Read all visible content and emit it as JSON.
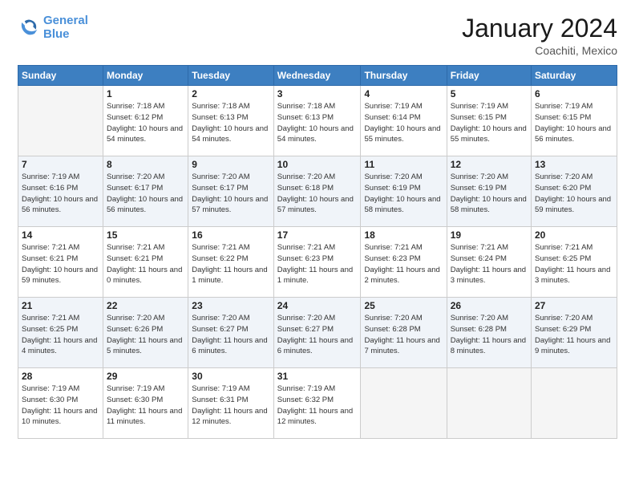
{
  "header": {
    "logo_line1": "General",
    "logo_line2": "Blue",
    "month": "January 2024",
    "location": "Coachiti, Mexico"
  },
  "days_of_week": [
    "Sunday",
    "Monday",
    "Tuesday",
    "Wednesday",
    "Thursday",
    "Friday",
    "Saturday"
  ],
  "weeks": [
    [
      {
        "num": "",
        "sunrise": "",
        "sunset": "",
        "daylight": ""
      },
      {
        "num": "1",
        "sunrise": "Sunrise: 7:18 AM",
        "sunset": "Sunset: 6:12 PM",
        "daylight": "Daylight: 10 hours and 54 minutes."
      },
      {
        "num": "2",
        "sunrise": "Sunrise: 7:18 AM",
        "sunset": "Sunset: 6:13 PM",
        "daylight": "Daylight: 10 hours and 54 minutes."
      },
      {
        "num": "3",
        "sunrise": "Sunrise: 7:18 AM",
        "sunset": "Sunset: 6:13 PM",
        "daylight": "Daylight: 10 hours and 54 minutes."
      },
      {
        "num": "4",
        "sunrise": "Sunrise: 7:19 AM",
        "sunset": "Sunset: 6:14 PM",
        "daylight": "Daylight: 10 hours and 55 minutes."
      },
      {
        "num": "5",
        "sunrise": "Sunrise: 7:19 AM",
        "sunset": "Sunset: 6:15 PM",
        "daylight": "Daylight: 10 hours and 55 minutes."
      },
      {
        "num": "6",
        "sunrise": "Sunrise: 7:19 AM",
        "sunset": "Sunset: 6:15 PM",
        "daylight": "Daylight: 10 hours and 56 minutes."
      }
    ],
    [
      {
        "num": "7",
        "sunrise": "Sunrise: 7:19 AM",
        "sunset": "Sunset: 6:16 PM",
        "daylight": "Daylight: 10 hours and 56 minutes."
      },
      {
        "num": "8",
        "sunrise": "Sunrise: 7:20 AM",
        "sunset": "Sunset: 6:17 PM",
        "daylight": "Daylight: 10 hours and 56 minutes."
      },
      {
        "num": "9",
        "sunrise": "Sunrise: 7:20 AM",
        "sunset": "Sunset: 6:17 PM",
        "daylight": "Daylight: 10 hours and 57 minutes."
      },
      {
        "num": "10",
        "sunrise": "Sunrise: 7:20 AM",
        "sunset": "Sunset: 6:18 PM",
        "daylight": "Daylight: 10 hours and 57 minutes."
      },
      {
        "num": "11",
        "sunrise": "Sunrise: 7:20 AM",
        "sunset": "Sunset: 6:19 PM",
        "daylight": "Daylight: 10 hours and 58 minutes."
      },
      {
        "num": "12",
        "sunrise": "Sunrise: 7:20 AM",
        "sunset": "Sunset: 6:19 PM",
        "daylight": "Daylight: 10 hours and 58 minutes."
      },
      {
        "num": "13",
        "sunrise": "Sunrise: 7:20 AM",
        "sunset": "Sunset: 6:20 PM",
        "daylight": "Daylight: 10 hours and 59 minutes."
      }
    ],
    [
      {
        "num": "14",
        "sunrise": "Sunrise: 7:21 AM",
        "sunset": "Sunset: 6:21 PM",
        "daylight": "Daylight: 10 hours and 59 minutes."
      },
      {
        "num": "15",
        "sunrise": "Sunrise: 7:21 AM",
        "sunset": "Sunset: 6:21 PM",
        "daylight": "Daylight: 11 hours and 0 minutes."
      },
      {
        "num": "16",
        "sunrise": "Sunrise: 7:21 AM",
        "sunset": "Sunset: 6:22 PM",
        "daylight": "Daylight: 11 hours and 1 minute."
      },
      {
        "num": "17",
        "sunrise": "Sunrise: 7:21 AM",
        "sunset": "Sunset: 6:23 PM",
        "daylight": "Daylight: 11 hours and 1 minute."
      },
      {
        "num": "18",
        "sunrise": "Sunrise: 7:21 AM",
        "sunset": "Sunset: 6:23 PM",
        "daylight": "Daylight: 11 hours and 2 minutes."
      },
      {
        "num": "19",
        "sunrise": "Sunrise: 7:21 AM",
        "sunset": "Sunset: 6:24 PM",
        "daylight": "Daylight: 11 hours and 3 minutes."
      },
      {
        "num": "20",
        "sunrise": "Sunrise: 7:21 AM",
        "sunset": "Sunset: 6:25 PM",
        "daylight": "Daylight: 11 hours and 3 minutes."
      }
    ],
    [
      {
        "num": "21",
        "sunrise": "Sunrise: 7:21 AM",
        "sunset": "Sunset: 6:25 PM",
        "daylight": "Daylight: 11 hours and 4 minutes."
      },
      {
        "num": "22",
        "sunrise": "Sunrise: 7:20 AM",
        "sunset": "Sunset: 6:26 PM",
        "daylight": "Daylight: 11 hours and 5 minutes."
      },
      {
        "num": "23",
        "sunrise": "Sunrise: 7:20 AM",
        "sunset": "Sunset: 6:27 PM",
        "daylight": "Daylight: 11 hours and 6 minutes."
      },
      {
        "num": "24",
        "sunrise": "Sunrise: 7:20 AM",
        "sunset": "Sunset: 6:27 PM",
        "daylight": "Daylight: 11 hours and 6 minutes."
      },
      {
        "num": "25",
        "sunrise": "Sunrise: 7:20 AM",
        "sunset": "Sunset: 6:28 PM",
        "daylight": "Daylight: 11 hours and 7 minutes."
      },
      {
        "num": "26",
        "sunrise": "Sunrise: 7:20 AM",
        "sunset": "Sunset: 6:28 PM",
        "daylight": "Daylight: 11 hours and 8 minutes."
      },
      {
        "num": "27",
        "sunrise": "Sunrise: 7:20 AM",
        "sunset": "Sunset: 6:29 PM",
        "daylight": "Daylight: 11 hours and 9 minutes."
      }
    ],
    [
      {
        "num": "28",
        "sunrise": "Sunrise: 7:19 AM",
        "sunset": "Sunset: 6:30 PM",
        "daylight": "Daylight: 11 hours and 10 minutes."
      },
      {
        "num": "29",
        "sunrise": "Sunrise: 7:19 AM",
        "sunset": "Sunset: 6:30 PM",
        "daylight": "Daylight: 11 hours and 11 minutes."
      },
      {
        "num": "30",
        "sunrise": "Sunrise: 7:19 AM",
        "sunset": "Sunset: 6:31 PM",
        "daylight": "Daylight: 11 hours and 12 minutes."
      },
      {
        "num": "31",
        "sunrise": "Sunrise: 7:19 AM",
        "sunset": "Sunset: 6:32 PM",
        "daylight": "Daylight: 11 hours and 12 minutes."
      },
      {
        "num": "",
        "sunrise": "",
        "sunset": "",
        "daylight": ""
      },
      {
        "num": "",
        "sunrise": "",
        "sunset": "",
        "daylight": ""
      },
      {
        "num": "",
        "sunrise": "",
        "sunset": "",
        "daylight": ""
      }
    ]
  ]
}
